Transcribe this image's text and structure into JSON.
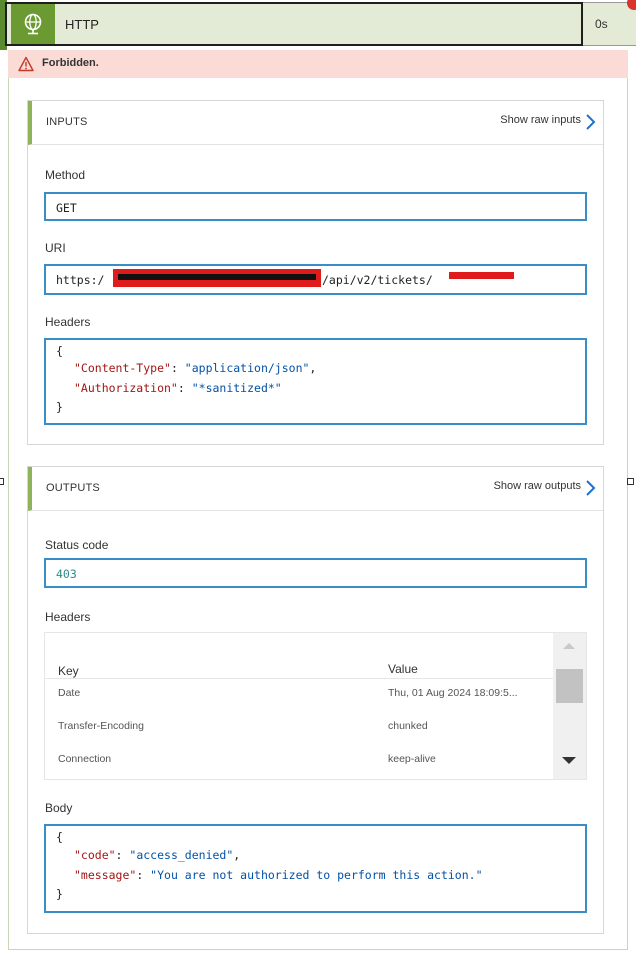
{
  "header": {
    "title": "HTTP",
    "duration": "0s"
  },
  "error": {
    "message": "Forbidden."
  },
  "inputs": {
    "section_title": "INPUTS",
    "raw_link": "Show raw inputs",
    "method_label": "Method",
    "method_value": "GET",
    "uri_label": "URI",
    "uri_prefix": "https:/",
    "uri_middle": "/api/v2/tickets/",
    "headers_label": "Headers",
    "headers_json": {
      "open": "{",
      "line1_key": "\"Content-Type\"",
      "line1_sep": ": ",
      "line1_val": "\"application/json\"",
      "line1_end": ",",
      "line2_key": "\"Authorization\"",
      "line2_sep": ": ",
      "line2_val": "\"*sanitized*\"",
      "close": "}"
    }
  },
  "outputs": {
    "section_title": "OUTPUTS",
    "raw_link": "Show raw outputs",
    "status_label": "Status code",
    "status_value": "403",
    "headers_label": "Headers",
    "headers_table": {
      "key_header": "Key",
      "value_header": "Value",
      "rows": [
        {
          "key": "Date",
          "value": "Thu, 01 Aug 2024 18:09:5..."
        },
        {
          "key": "Transfer-Encoding",
          "value": "chunked"
        },
        {
          "key": "Connection",
          "value": "keep-alive"
        }
      ]
    },
    "body_label": "Body",
    "body_json": {
      "open": "{",
      "line1_key": "\"code\"",
      "line1_sep": ": ",
      "line1_val": "\"access_denied\"",
      "line1_end": ",",
      "line2_key": "\"message\"",
      "line2_sep": ": ",
      "line2_val": "\"You are not authorized to perform this action.\"",
      "close": "}"
    }
  },
  "colors": {
    "accent_green": "#6b9a32",
    "error_bg": "#fadbd5",
    "field_border": "#3a8dc6",
    "json_key": "#a31515",
    "json_string": "#0451a5",
    "redaction": "#e01b1b"
  },
  "icons": {
    "action": "globe-icon",
    "warning": "warning-icon",
    "chevron": "chevron-right-icon"
  }
}
